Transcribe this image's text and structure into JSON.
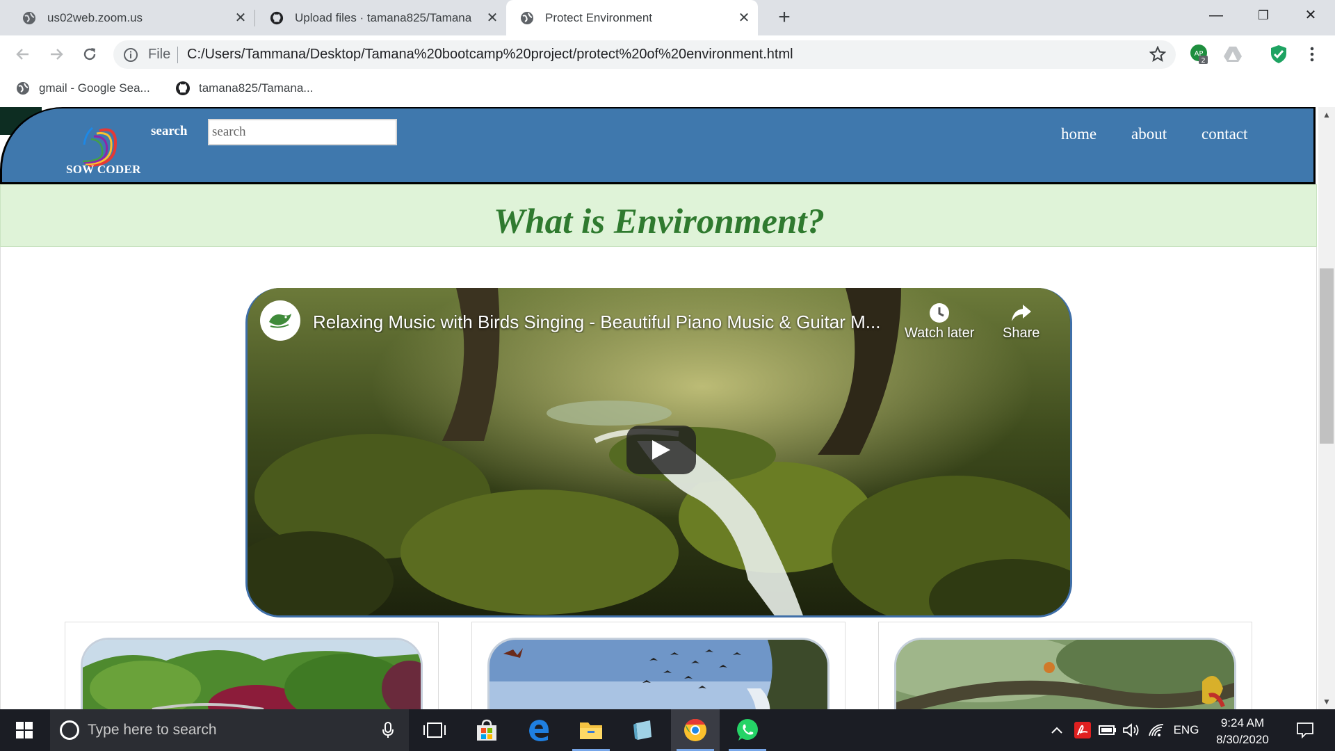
{
  "browser": {
    "tabs": [
      {
        "title": "us02web.zoom.us",
        "icon": "globe-icon",
        "active": false
      },
      {
        "title": "Upload files · tamana825/Tamana",
        "icon": "github-icon",
        "active": false
      },
      {
        "title": "Protect Environment",
        "icon": "globe-icon",
        "active": true
      }
    ],
    "omnibox": {
      "scheme_label": "File",
      "url": "C:/Users/Tammana/Desktop/Tamana%20bootcamp%20project/protect%20of%20environment.html"
    },
    "extension_badge": "2",
    "extension_label": "AP",
    "bookmarks": [
      {
        "label": "gmail - Google Sea...",
        "icon": "globe-icon"
      },
      {
        "label": "tamana825/Tamana...",
        "icon": "github-icon"
      }
    ]
  },
  "site": {
    "logo_text": "SOW CODER",
    "search_label": "search",
    "search_placeholder": "search",
    "nav": [
      "home",
      "about",
      "contact"
    ],
    "page_title": "What is Environment?"
  },
  "video": {
    "title": "Relaxing Music with Birds Singing - Beautiful Piano Music & Guitar M...",
    "watch_later": "Watch later",
    "share": "Share"
  },
  "taskbar": {
    "search_placeholder": "Type here to search",
    "language": "ENG",
    "time": "9:24 AM",
    "date": "8/30/2020"
  },
  "colors": {
    "header_bg": "#3f78ad",
    "title_band_bg": "#dff3d8",
    "title_color": "#2f7a2f",
    "taskbar_bg": "#1b1d24"
  }
}
